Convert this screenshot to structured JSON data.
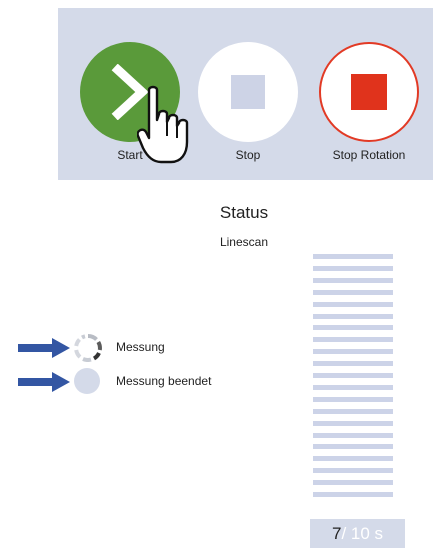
{
  "toolbar": {
    "start_label": "Start",
    "stop_label": "Stop",
    "stop_rotation_label": "Stop Rotation"
  },
  "status": {
    "title": "Status",
    "mode": "Linescan"
  },
  "legend": {
    "items": [
      {
        "label": "Messung",
        "indicator": "spinner-ring-icon"
      },
      {
        "label": "Messung beendet",
        "indicator": "filled-dot-icon"
      }
    ]
  },
  "progress": {
    "segments_total": 21,
    "current": "7",
    "total": "/ 10 s"
  },
  "colors": {
    "start": "#5a9a3a",
    "stop_rotation": "#e0331c",
    "panel": "#d4dae9",
    "arrow": "#3356a3"
  }
}
